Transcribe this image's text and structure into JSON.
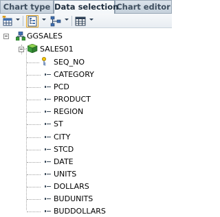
{
  "tabs": [
    {
      "label": "Chart type"
    },
    {
      "label": "Data selection",
      "selected": true
    },
    {
      "label": "Chart editor"
    }
  ],
  "toolbar": {
    "buttons": [
      {
        "icon": "add-table-icon",
        "has_dropdown": true
      },
      {
        "icon": "tree-view-icon",
        "active": true,
        "has_dropdown": true
      },
      {
        "icon": "hierarchy-icon",
        "has_dropdown": true
      },
      {
        "icon": "grid-columns-icon",
        "has_dropdown": true
      }
    ]
  },
  "tree": {
    "root": {
      "label": "GGSALES",
      "icon": "database-network-icon",
      "expanded": true
    },
    "segment": {
      "label": "SALES01",
      "icon": "segment-green-icon",
      "expanded": true
    },
    "key_field": {
      "label": "SEQ_NO",
      "icon": "key-field-icon"
    },
    "fields": [
      "CATEGORY",
      "PCD",
      "PRODUCT",
      "REGION",
      "ST",
      "CITY",
      "STCD",
      "DATE",
      "UNITS",
      "DOLLARS",
      "BUDUNITS",
      "BUDDOLLARS"
    ]
  },
  "colors": {
    "tab_active_bg": "#f4f7fa",
    "tab_inactive_bg": "#c5d0db",
    "toolbar_active_border": "#e0a42a",
    "tree_line": "#a0a0a0"
  }
}
